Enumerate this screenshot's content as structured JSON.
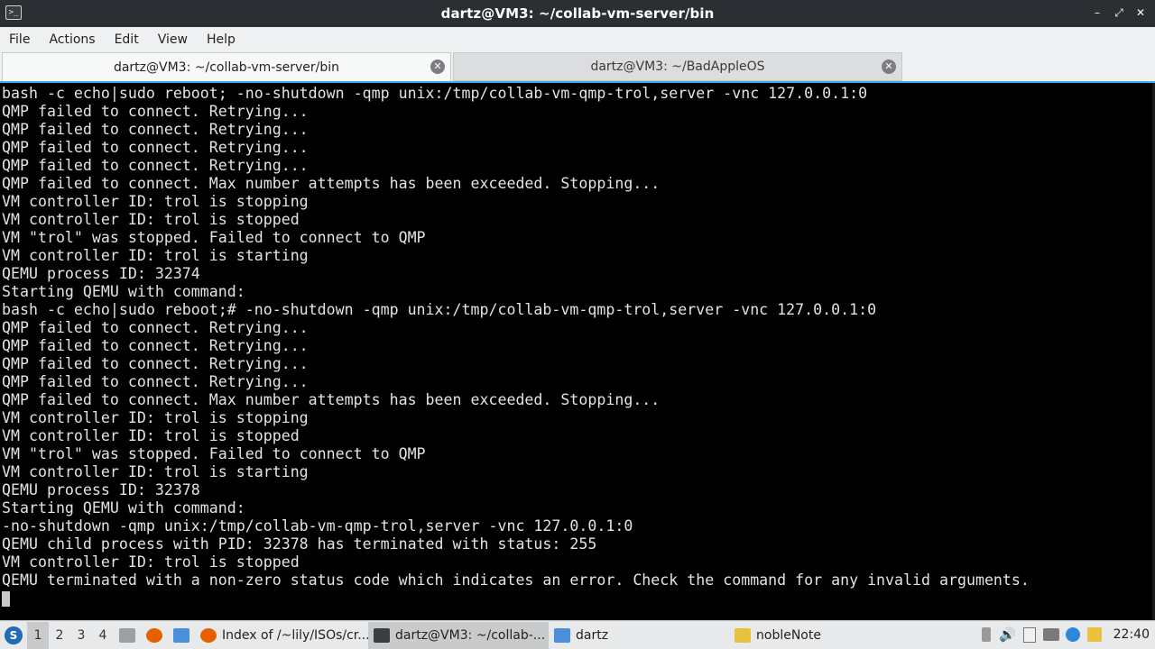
{
  "window": {
    "title": "dartz@VM3: ~/collab-vm-server/bin",
    "app_icon_glyph": ">_",
    "controls": {
      "minimize": "–",
      "maximize": "⤢",
      "close": "✕"
    }
  },
  "menu": [
    "File",
    "Actions",
    "Edit",
    "View",
    "Help"
  ],
  "tabs": [
    {
      "label": "dartz@VM3: ~/collab-vm-server/bin",
      "active": true
    },
    {
      "label": "dartz@VM3: ~/BadAppleOS",
      "active": false
    }
  ],
  "terminal": {
    "lines": [
      "bash -c echo|sudo reboot; -no-shutdown -qmp unix:/tmp/collab-vm-qmp-trol,server -vnc 127.0.0.1:0",
      "QMP failed to connect. Retrying...",
      "QMP failed to connect. Retrying...",
      "QMP failed to connect. Retrying...",
      "QMP failed to connect. Retrying...",
      "QMP failed to connect. Max number attempts has been exceeded. Stopping...",
      "VM controller ID: trol is stopping",
      "VM controller ID: trol is stopped",
      "VM \"trol\" was stopped. Failed to connect to QMP",
      "VM controller ID: trol is starting",
      "QEMU process ID: 32374",
      "Starting QEMU with command:",
      "bash -c echo|sudo reboot;# -no-shutdown -qmp unix:/tmp/collab-vm-qmp-trol,server -vnc 127.0.0.1:0",
      "QMP failed to connect. Retrying...",
      "QMP failed to connect. Retrying...",
      "QMP failed to connect. Retrying...",
      "QMP failed to connect. Retrying...",
      "QMP failed to connect. Max number attempts has been exceeded. Stopping...",
      "VM controller ID: trol is stopping",
      "VM controller ID: trol is stopped",
      "VM \"trol\" was stopped. Failed to connect to QMP",
      "VM controller ID: trol is starting",
      "QEMU process ID: 32378",
      "Starting QEMU with command:",
      "-no-shutdown -qmp unix:/tmp/collab-vm-qmp-trol,server -vnc 127.0.0.1:0",
      "QEMU child process with PID: 32378 has terminated with status: 255",
      "VM controller ID: trol is stopped",
      "QEMU terminated with a non-zero status code which indicates an error. Check the command for any invalid arguments."
    ]
  },
  "taskbar": {
    "start_glyph": "S",
    "workspaces": [
      {
        "label": "1",
        "active": true
      },
      {
        "label": "2",
        "active": false
      },
      {
        "label": "3",
        "active": false
      },
      {
        "label": "4",
        "active": false
      }
    ],
    "tasks": [
      {
        "label": "Index of /~lily/ISOs/cr...",
        "icon": "firefox-icon",
        "color": "#e66000",
        "active": false
      },
      {
        "label": "dartz@VM3: ~/collab-...",
        "icon": "terminal-icon",
        "color": "#3a3d42",
        "active": true
      },
      {
        "label": "dartz",
        "icon": "folder-icon",
        "color": "#4a90d9",
        "active": false
      },
      {
        "label": "nobleNote",
        "icon": "note-icon",
        "color": "#e8c23a",
        "active": false
      }
    ],
    "clock": "22:40"
  }
}
